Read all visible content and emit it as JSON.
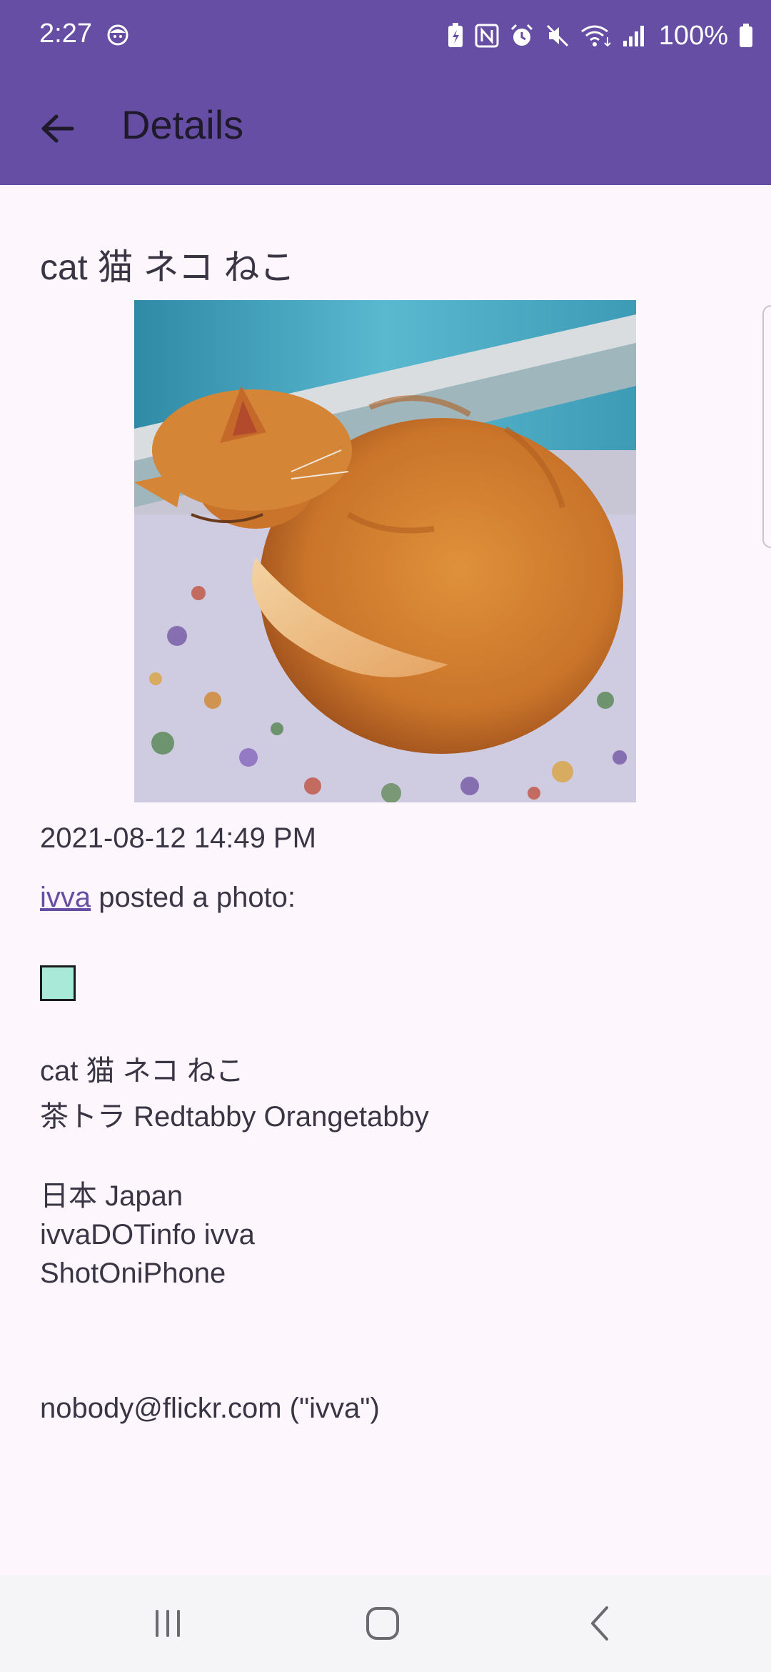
{
  "status_bar": {
    "time": "2:27",
    "battery_percent": "100%",
    "icons": [
      "face-icon",
      "battery-saver-icon",
      "nfc-icon",
      "alarm-icon",
      "mute-icon",
      "wifi-icon",
      "signal-icon",
      "battery-icon"
    ]
  },
  "app_bar": {
    "title": "Details",
    "back_icon": "arrow-back-icon",
    "background_color": "#654ea3"
  },
  "post": {
    "title": "cat 猫 ネコ ねこ",
    "image_alt": "cat 猫 ネコ ねこ",
    "timestamp": "2021-08-12 14:49 PM",
    "user": "ivva",
    "posted_text": " posted a photo:",
    "swatch_color": "#a8e9d8",
    "description_lines": [
      "cat 猫 ネコ ねこ",
      "茶トラ Redtabby Orangetabby"
    ],
    "tag_lines": [
      "日本 Japan",
      "ivvaDOTinfo ivva",
      "ShotOniPhone"
    ],
    "author_email": "nobody@flickr.com (\"ivva\")"
  },
  "nav_bar": {
    "buttons": [
      "recent-apps-icon",
      "home-icon",
      "back-icon"
    ]
  }
}
